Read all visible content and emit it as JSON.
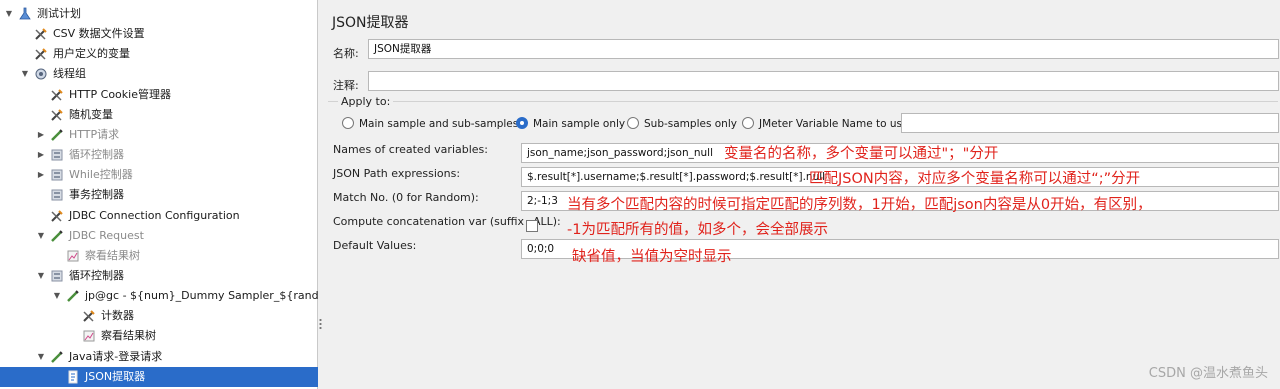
{
  "tree": {
    "items": [
      {
        "label": "测试计划",
        "icon": "test-plan-icon"
      },
      {
        "label": "CSV 数据文件设置",
        "icon": "config-icon"
      },
      {
        "label": "用户定义的变量",
        "icon": "config-icon"
      },
      {
        "label": "线程组",
        "icon": "thread-group-icon"
      },
      {
        "label": "HTTP Cookie管理器",
        "icon": "config-icon"
      },
      {
        "label": "随机变量",
        "icon": "config-icon"
      },
      {
        "label": "HTTP请求",
        "icon": "sampler-icon"
      },
      {
        "label": "循环控制器",
        "icon": "controller-icon"
      },
      {
        "label": "While控制器",
        "icon": "controller-icon"
      },
      {
        "label": "事务控制器",
        "icon": "controller-icon"
      },
      {
        "label": "JDBC Connection Configuration",
        "icon": "config-icon"
      },
      {
        "label": "JDBC Request",
        "icon": "sampler-icon"
      },
      {
        "label": "察看结果树",
        "icon": "listener-icon"
      },
      {
        "label": "循环控制器",
        "icon": "controller-icon"
      },
      {
        "label": "jp@gc - ${num}_Dummy Sampler_${random}",
        "icon": "sampler-icon"
      },
      {
        "label": "计数器",
        "icon": "config-icon"
      },
      {
        "label": "察看结果树",
        "icon": "listener-icon"
      },
      {
        "label": "Java请求-登录请求",
        "icon": "sampler-icon"
      },
      {
        "label": "JSON提取器",
        "icon": "post-processor-icon"
      }
    ]
  },
  "panel": {
    "title": "JSON提取器",
    "name_label": "名称:",
    "name_value": "JSON提取器",
    "comment_label": "注释:",
    "comment_value": "",
    "apply_to_label": "Apply to:",
    "apply_options": [
      "Main sample and sub-samples",
      "Main sample only",
      "Sub-samples only",
      "JMeter Variable Name to use"
    ],
    "apply_selected": "Main sample only",
    "jmeter_var_value": "",
    "vars_label": "Names of created variables:",
    "vars_value": "json_name;json_password;json_null",
    "paths_label": "JSON Path expressions:",
    "paths_value": "$.result[*].username;$.result[*].password;$.result[*].null",
    "match_label": "Match No. (0 for Random):",
    "match_value": "2;-1;3",
    "concat_label": "Compute concatenation var (suffix _ALL):",
    "concat_checked": false,
    "default_label": "Default Values:",
    "default_value": "0;0;0"
  },
  "annotations": {
    "vars": "变量名的名称，多个变量可以通过\"；\"分开",
    "paths": "匹配JSON内容，对应多个变量名称可以通过“;”分开",
    "match_1": "当有多个匹配内容的时候可指定匹配的序列数，1开始，匹配json内容是从0开始，有区别，",
    "match_2": "-1为匹配所有的值，如多个，会全部展示",
    "default": "缺省值，当值为空时显示"
  },
  "watermark": "CSDN @温水煮鱼头",
  "colors": {
    "accent": "#2a6cc9",
    "annotation": "#e0231c"
  }
}
